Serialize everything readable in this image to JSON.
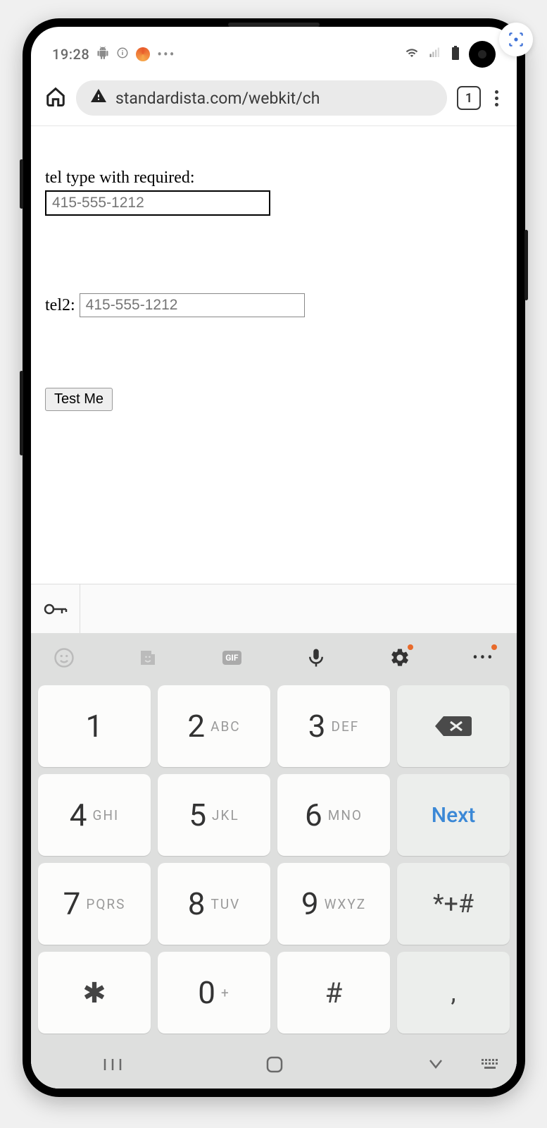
{
  "status": {
    "time": "19:28",
    "icons": [
      "android-icon",
      "info-icon",
      "app-icon",
      "more-dots-icon"
    ],
    "right_icons": [
      "wifi-icon",
      "signal-icon",
      "battery-icon"
    ]
  },
  "browser": {
    "url": "standardista.com/webkit/ch",
    "tab_count": "1"
  },
  "page": {
    "label1": "tel type with required:",
    "tel1_placeholder": "415-555-1212",
    "tel2_label": "tel2:",
    "tel2_placeholder": "415-555-1212",
    "test_button": "Test Me"
  },
  "keyboard": {
    "toolbar_icons": [
      "emoji-icon",
      "sticker-icon",
      "gif-icon",
      "mic-icon",
      "settings-icon",
      "more-icon"
    ],
    "keys": [
      {
        "digit": "1",
        "letters": ""
      },
      {
        "digit": "2",
        "letters": "ABC"
      },
      {
        "digit": "3",
        "letters": "DEF"
      },
      {
        "type": "backspace"
      },
      {
        "digit": "4",
        "letters": "GHI"
      },
      {
        "digit": "5",
        "letters": "JKL"
      },
      {
        "digit": "6",
        "letters": "MNO"
      },
      {
        "type": "next",
        "label": "Next"
      },
      {
        "digit": "7",
        "letters": "PQRS"
      },
      {
        "digit": "8",
        "letters": "TUV"
      },
      {
        "digit": "9",
        "letters": "WXYZ"
      },
      {
        "type": "sym",
        "label": "*+#"
      },
      {
        "type": "sym",
        "label": "✱",
        "variant": "asterisk"
      },
      {
        "digit": "0",
        "letters": "+"
      },
      {
        "type": "sym",
        "label": "#"
      },
      {
        "type": "sym",
        "label": ","
      }
    ],
    "next_label": "Next",
    "sym_key_label": "*+#",
    "asterisk": "✱",
    "hash": "#",
    "comma": ","
  }
}
